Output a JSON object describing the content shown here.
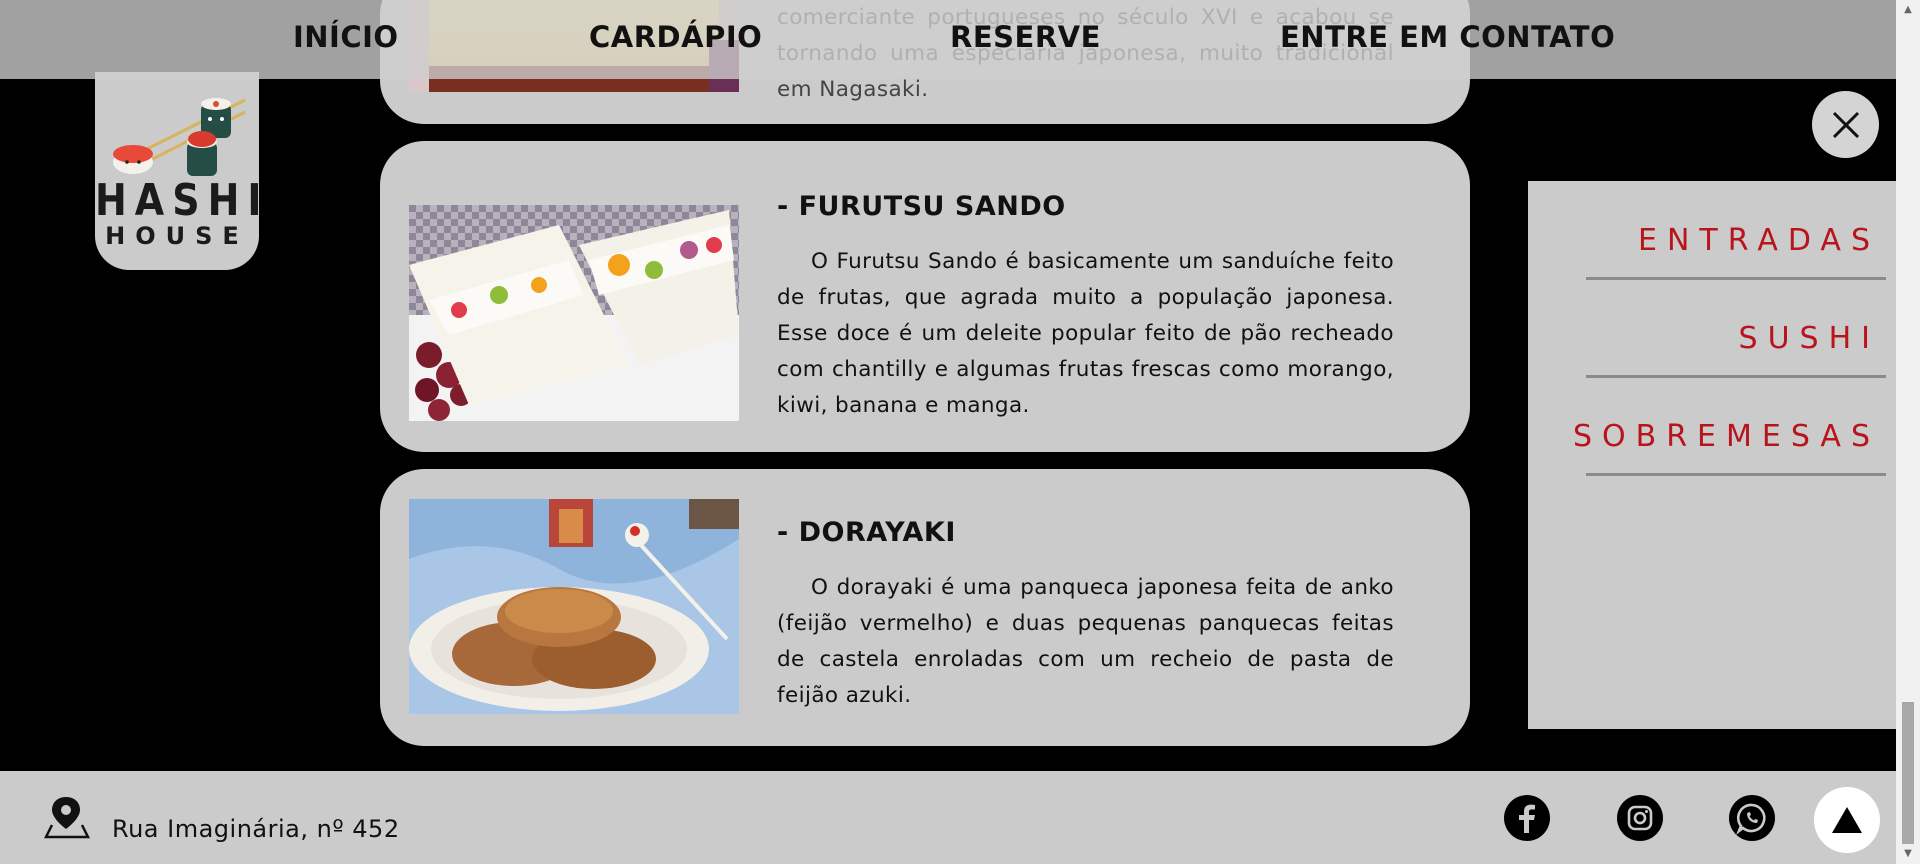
{
  "nav": {
    "items": [
      {
        "label": "INÍCIO"
      },
      {
        "label": "CARDÁPIO"
      },
      {
        "label": "RESERVE"
      },
      {
        "label": "ENTRE EM CONTATO"
      }
    ]
  },
  "logo": {
    "line1": "HASHI",
    "line2": "HOUSE"
  },
  "cards": [
    {
      "title": "",
      "text": "comerciante portugueses no século XVI e acabou se tornando uma especiaria japonesa, muito tradicional em Nagasaki."
    },
    {
      "title": "- FURUTSU SANDO",
      "text": "O Furutsu Sando é basicamente um sanduíche feito de frutas, que agrada muito a população japonesa. Esse doce é um deleite popular feito de pão recheado com chantilly e algumas frutas frescas como morango, kiwi, banana e manga."
    },
    {
      "title": "- DORAYAKI",
      "text": "O dorayaki é uma panqueca japonesa feita de anko (feijão vermelho) e duas pequenas panquecas feitas de castela enroladas com um recheio de pasta de feijão azuki."
    }
  ],
  "side_menu": {
    "items": [
      {
        "label": "ENTRADAS"
      },
      {
        "label": "SUSHI"
      },
      {
        "label": "SOBREMESAS"
      }
    ]
  },
  "close_icon": "close-icon",
  "footer": {
    "address": "Rua Imaginária, nº 452",
    "address_icon": "map-pin-icon",
    "social_icons": [
      "facebook-icon",
      "instagram-icon",
      "whatsapp-icon"
    ],
    "back_to_top_icon": "arrow-up-icon"
  },
  "colors": {
    "menu_text": "#b8141b",
    "card_bg": "#cbcbcb",
    "page_bg": "#000000"
  }
}
